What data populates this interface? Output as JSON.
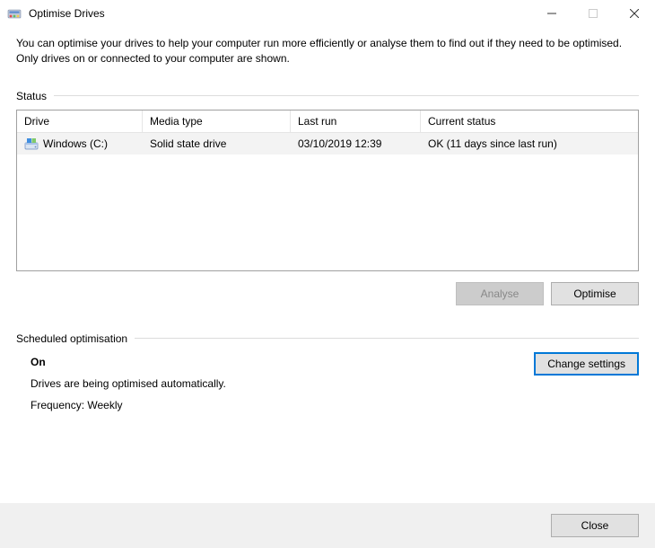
{
  "window": {
    "title": "Optimise Drives"
  },
  "description": "You can optimise your drives to help your computer run more efficiently or analyse them to find out if they need to be optimised. Only drives on or connected to your computer are shown.",
  "sections": {
    "status_label": "Status",
    "schedule_label": "Scheduled optimisation"
  },
  "table": {
    "headers": {
      "drive": "Drive",
      "media": "Media type",
      "last": "Last run",
      "status": "Current status"
    },
    "rows": [
      {
        "drive": "Windows (C:)",
        "media": "Solid state drive",
        "last": "03/10/2019 12:39",
        "status": "OK (11 days since last run)"
      }
    ]
  },
  "buttons": {
    "analyse": "Analyse",
    "optimise": "Optimise",
    "change_settings": "Change settings",
    "close": "Close"
  },
  "schedule": {
    "status": "On",
    "desc": "Drives are being optimised automatically.",
    "frequency": "Frequency: Weekly"
  }
}
